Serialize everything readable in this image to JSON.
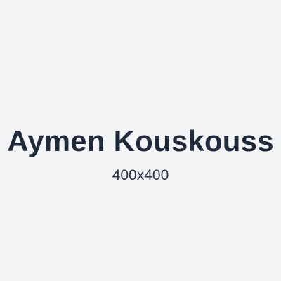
{
  "placeholder": {
    "name": "Aymen Kouskouss",
    "dimensions": "400x400"
  },
  "colors": {
    "background": "#f3f4f6",
    "text_primary": "#1f2a3a",
    "text_secondary": "#2a3444"
  }
}
